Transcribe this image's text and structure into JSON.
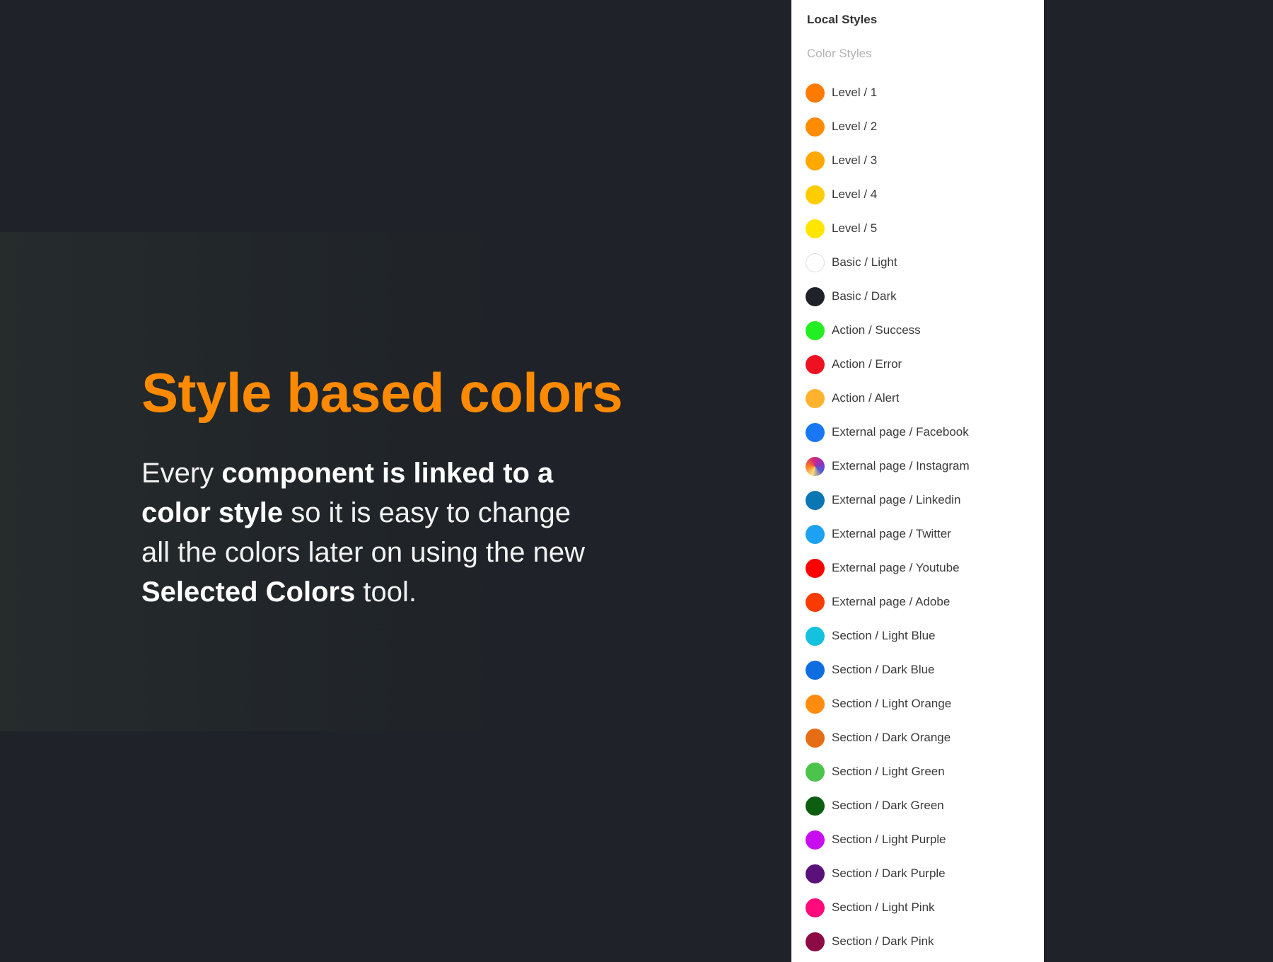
{
  "hero": {
    "title": "Style based colors",
    "body": [
      {
        "text": "Every ",
        "bold": false
      },
      {
        "text": "component is linked to a color style",
        "bold": true
      },
      {
        "text": " so it is easy to change all the colors later on using the new ",
        "bold": false
      },
      {
        "text": "Selected Colors",
        "bold": true
      },
      {
        "text": " tool.",
        "bold": false
      }
    ],
    "accent_color": "#ff8a00"
  },
  "panel": {
    "title": "Local Styles",
    "subtitle": "Color Styles",
    "styles": [
      {
        "label": "Level / 1",
        "color": "#ff7a00"
      },
      {
        "label": "Level / 2",
        "color": "#ff8c00"
      },
      {
        "label": "Level / 3",
        "color": "#ffa800"
      },
      {
        "label": "Level / 4",
        "color": "#ffcc00"
      },
      {
        "label": "Level / 5",
        "color": "#ffe600"
      },
      {
        "label": "Basic / Light",
        "color": "#ffffff",
        "outlined": true
      },
      {
        "label": "Basic / Dark",
        "color": "#1f2329"
      },
      {
        "label": "Action / Success",
        "color": "#22ee22"
      },
      {
        "label": "Action / Error",
        "color": "#ee1122"
      },
      {
        "label": "Action / Alert",
        "color": "#ffb22e"
      },
      {
        "label": "External page / Facebook",
        "color": "#1877f2"
      },
      {
        "label": "External page / Instagram",
        "color": "conic-gradient(from 200deg, #feda75, #fa7e1e, #d62976, #962fbf, #4f5bd5, #feda75)"
      },
      {
        "label": "External page / Linkedin",
        "color": "#0a76b4"
      },
      {
        "label": "External page / Twitter",
        "color": "#1da1f2"
      },
      {
        "label": "External page / Youtube",
        "color": "#ff0000"
      },
      {
        "label": "External page / Adobe",
        "color": "#fa3b00"
      },
      {
        "label": "Section / Light Blue",
        "color": "#14c1de"
      },
      {
        "label": "Section / Dark Blue",
        "color": "#0e6ee0"
      },
      {
        "label": "Section / Light Orange",
        "color": "#ff8c0f"
      },
      {
        "label": "Section / Dark Orange",
        "color": "#e56d13"
      },
      {
        "label": "Section / Light Green",
        "color": "#4cc44c"
      },
      {
        "label": "Section / Dark Green",
        "color": "#0e5e12"
      },
      {
        "label": "Section / Light Purple",
        "color": "#c80ef0"
      },
      {
        "label": "Section / Dark Purple",
        "color": "#5a117a"
      },
      {
        "label": "Section / Light Pink",
        "color": "#ff0a7a"
      },
      {
        "label": "Section / Dark Pink",
        "color": "#8c0b45"
      }
    ]
  }
}
